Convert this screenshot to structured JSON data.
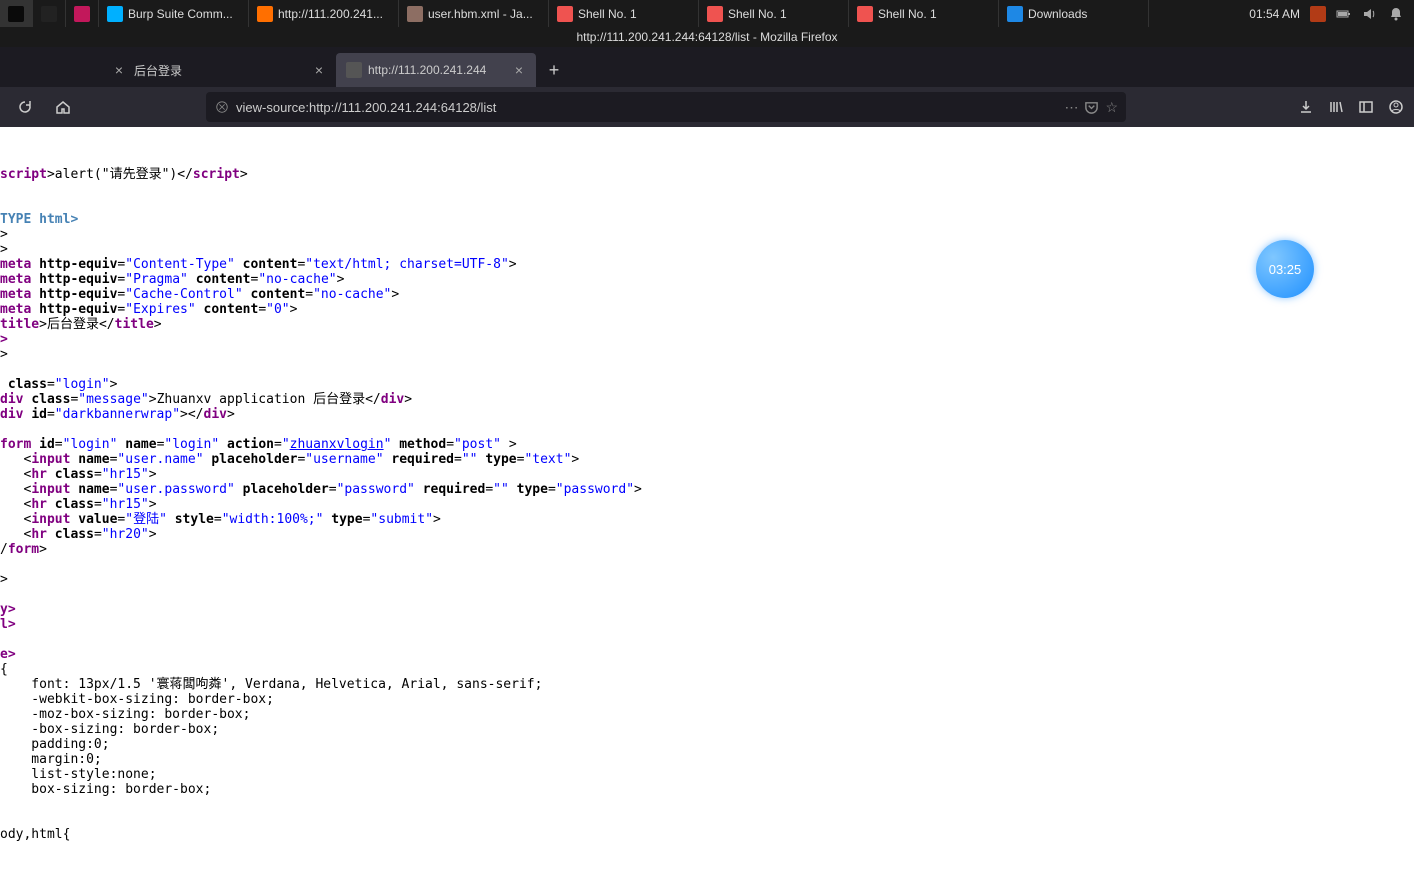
{
  "taskbar": {
    "items": [
      {
        "icon": "terminal-icon",
        "label": ""
      },
      {
        "icon": "terminal2-icon",
        "label": ""
      },
      {
        "icon": "app-icon",
        "label": ""
      },
      {
        "icon": "burp-icon",
        "label": "Burp Suite Comm..."
      },
      {
        "icon": "firefox-icon",
        "label": "http://111.200.241..."
      },
      {
        "icon": "file-icon",
        "label": "user.hbm.xml - Ja..."
      },
      {
        "icon": "shell-icon",
        "label": "Shell No. 1"
      },
      {
        "icon": "shell-icon",
        "label": "Shell No. 1"
      },
      {
        "icon": "shell-icon",
        "label": "Shell No. 1"
      },
      {
        "icon": "files-icon",
        "label": "Downloads"
      }
    ],
    "time": "01:54 AM"
  },
  "window_title": "http://111.200.241.244:64128/list - Mozilla Firefox",
  "tabs": [
    {
      "label": "后台登录",
      "active": false,
      "closable": true
    },
    {
      "label": "http://111.200.241.244",
      "active": true,
      "closable": true
    }
  ],
  "url": "view-source:http://111.200.241.244:64128/list",
  "timer": "03:25",
  "source": {
    "l1_text": "alert(\"请先登录\")</",
    "l1b": ">",
    "doctype": "TYPE html>",
    "ang": ">",
    "meta1_attr1": "http-equiv",
    "meta1_val1": "\"Content-Type\"",
    "meta1_attr2": "content",
    "meta1_val2": "\"text/html; charset=UTF-8\"",
    "meta2_attr1": "http-equiv",
    "meta2_val1": "\"Pragma\"",
    "meta2_attr2": "content",
    "meta2_val2": "\"no-cache\"",
    "meta3_attr1": "http-equiv",
    "meta3_val1": "\"Cache-Control\"",
    "meta3_attr2": "content",
    "meta3_val2": "\"no-cache\"",
    "meta4_attr1": "http-equiv",
    "meta4_val1": "\"Expires\"",
    "meta4_attr2": "content",
    "meta4_val2": "\"0\"",
    "title_open": "title",
    "title_text": "后台登录",
    "title_close": "title",
    "d": ">",
    "class": "class",
    "login": "\"login\"",
    "div": "div",
    "message": "\"message\"",
    "zh": "Zhuanxv application 后台登录",
    "id": "id",
    "dark": "\"darkbannerwrap\"",
    "form": "form",
    "formid": "\"login\"",
    "name": "name",
    "nlogin": "\"login\"",
    "action": "action",
    "actval": "zhuanxvlogin",
    "method": "method",
    "methval": "\"post\"",
    "input": "input",
    "uname": "\"user.name\"",
    "placeholder": "placeholder",
    "ph1": "\"username\"",
    "required": "required",
    "req": "\"\"",
    "type": "type",
    "ttext": "\"text\"",
    "hr": "hr",
    "hr15": "\"hr15\"",
    "upass": "\"user.password\"",
    "ph2": "\"password\"",
    "tpass": "\"password\"",
    "value": "value",
    "submit_lb": "\"登陆\"",
    "style": "style",
    "styleval": "\"width:100%;\"",
    "tsubmit": "\"submit\"",
    "hr20": "\"hr20\"",
    "y": "y>",
    "l": "l>",
    "e": "e>",
    "css_block": "{\n    font: 13px/1.5 '寰蒋闆呴粦', Verdana, Helvetica, Arial, sans-serif;\n    -webkit-box-sizing: border-box;\n    -moz-box-sizing: border-box;\n    -box-sizing: border-box;\n    padding:0;\n    margin:0;\n    list-style:none;\n    box-sizing: border-box;\n\n",
    "bodyhtml": "ody,html{"
  }
}
